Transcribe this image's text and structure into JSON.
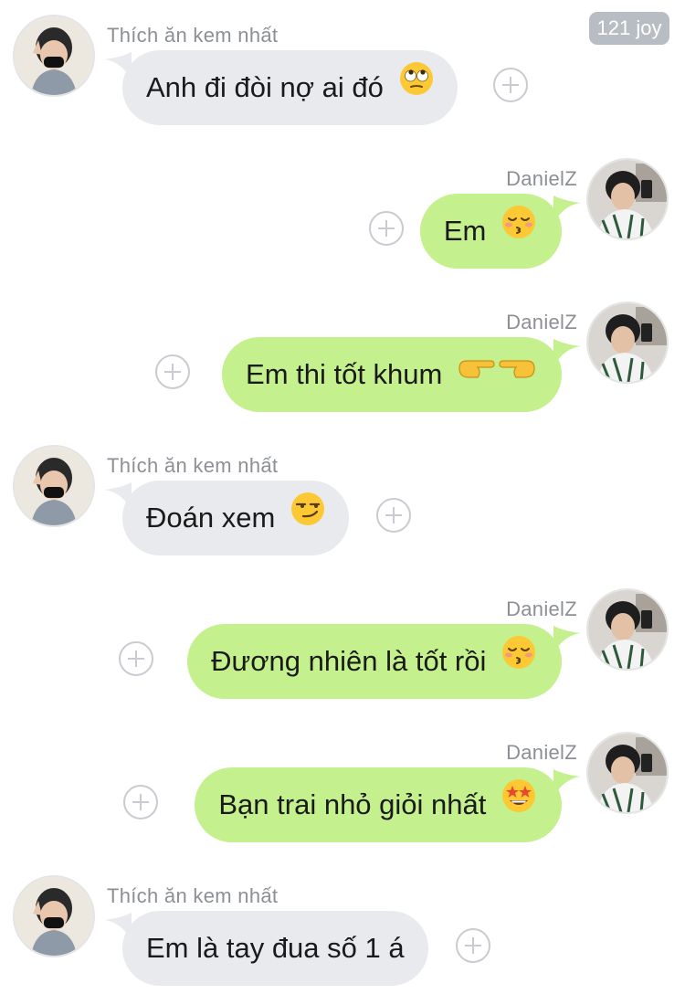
{
  "watermark": "121 joy",
  "senders": {
    "left": "Thích ăn kem nhất",
    "right": "DanielZ"
  },
  "messages": [
    {
      "side": "left",
      "sender": "Thích ăn kem nhất",
      "text": "Anh đi đòi nợ ai đó",
      "emoji": "rolling-eyes-emoji"
    },
    {
      "side": "right",
      "sender": "DanielZ",
      "text": "Em",
      "emoji": "kissing-closed-eyes-emoji"
    },
    {
      "side": "right",
      "sender": "DanielZ",
      "text": "Em thi tốt khum",
      "emoji": "fingers-pointing-emoji"
    },
    {
      "side": "left",
      "sender": "Thích ăn kem nhất",
      "text": "Đoán xem",
      "emoji": "smirking-emoji"
    },
    {
      "side": "right",
      "sender": "DanielZ",
      "text": "Đương nhiên là tốt rồi",
      "emoji": "kissing-closed-eyes-emoji"
    },
    {
      "side": "right",
      "sender": "DanielZ",
      "text": "Bạn trai nhỏ giỏi nhất",
      "emoji": "star-struck-emoji"
    },
    {
      "side": "left",
      "sender": "Thích ăn kem nhất",
      "text": "Em là tay đua số 1 á",
      "emoji": ""
    }
  ],
  "colors": {
    "left_bubble": "#e8eaee",
    "right_bubble": "#c4f08e",
    "sender_text": "#8c8f94",
    "plus_icon": "#c9cbd0"
  }
}
